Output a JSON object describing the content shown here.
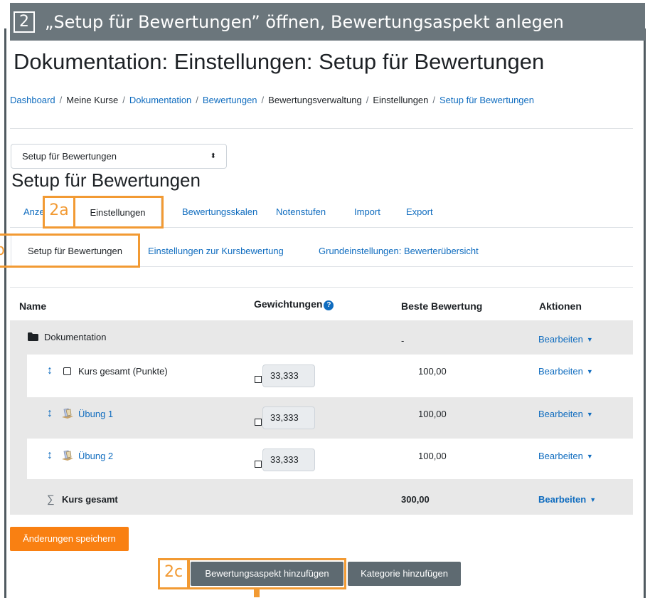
{
  "instruction": {
    "step_number": "2",
    "text": "„Setup für Bewertungen” öffnen, Bewertungsaspekt anlegen"
  },
  "page_title": "Dokumentation: Einstellungen: Setup für Bewertungen",
  "breadcrumb": [
    {
      "label": "Dashboard",
      "link": true
    },
    {
      "label": "Meine Kurse",
      "link": false
    },
    {
      "label": "Dokumentation",
      "link": true
    },
    {
      "label": "Bewertungen",
      "link": true
    },
    {
      "label": "Bewertungsverwaltung",
      "link": false
    },
    {
      "label": "Einstellungen",
      "link": false
    },
    {
      "label": "Setup für Bewertungen",
      "link": true
    }
  ],
  "breadcrumb_separator": "/",
  "select": {
    "value": "Setup für Bewertungen",
    "arrow": "⬍"
  },
  "section_title": "Setup für Bewertungen",
  "tabs": [
    {
      "label": "Anze",
      "active": false
    },
    {
      "label": "Einstellungen",
      "active": true
    },
    {
      "label": "Bewertungsskalen",
      "active": false
    },
    {
      "label": "Notenstufen",
      "active": false
    },
    {
      "label": "Import",
      "active": false
    },
    {
      "label": "Export",
      "active": false
    }
  ],
  "subtabs": [
    {
      "label": "Setup für Bewertungen",
      "active": true
    },
    {
      "label": "Einstellungen zur Kursbewertung",
      "active": false
    },
    {
      "label": "Grundeinstellungen: Bewerterübersicht",
      "active": false
    }
  ],
  "markers": {
    "a": "2a",
    "b": "b",
    "c": "2c"
  },
  "table": {
    "headers": {
      "name": "Name",
      "weights": "Gewichtungen",
      "best": "Beste Bewertung",
      "actions": "Aktionen"
    },
    "help_icon": "?",
    "category": {
      "name": "Dokumentation",
      "best": "-",
      "action": "Bearbeiten"
    },
    "rows": [
      {
        "name": "Kurs gesamt (Punkte)",
        "weight": "33,333",
        "best": "100,00",
        "action": "Bearbeiten"
      },
      {
        "name": "Übung 1",
        "weight": "33,333",
        "best": "100,00",
        "action": "Bearbeiten"
      },
      {
        "name": "Übung 2",
        "weight": "33,333",
        "best": "100,00",
        "action": "Bearbeiten"
      }
    ],
    "total": {
      "name": "Kurs gesamt",
      "best": "300,00",
      "action": "Bearbeiten"
    }
  },
  "buttons": {
    "save": "Änderungen speichern",
    "add_item": "Bewertungsaspekt hinzufügen",
    "add_category": "Kategorie hinzufügen"
  },
  "icons": {
    "move": "↕",
    "sum": "∑",
    "caret": "▼"
  },
  "colors": {
    "accent": "#f29a33",
    "link": "#0f6cbf",
    "save_button": "#f98012",
    "titlebar": "#6b767c"
  }
}
